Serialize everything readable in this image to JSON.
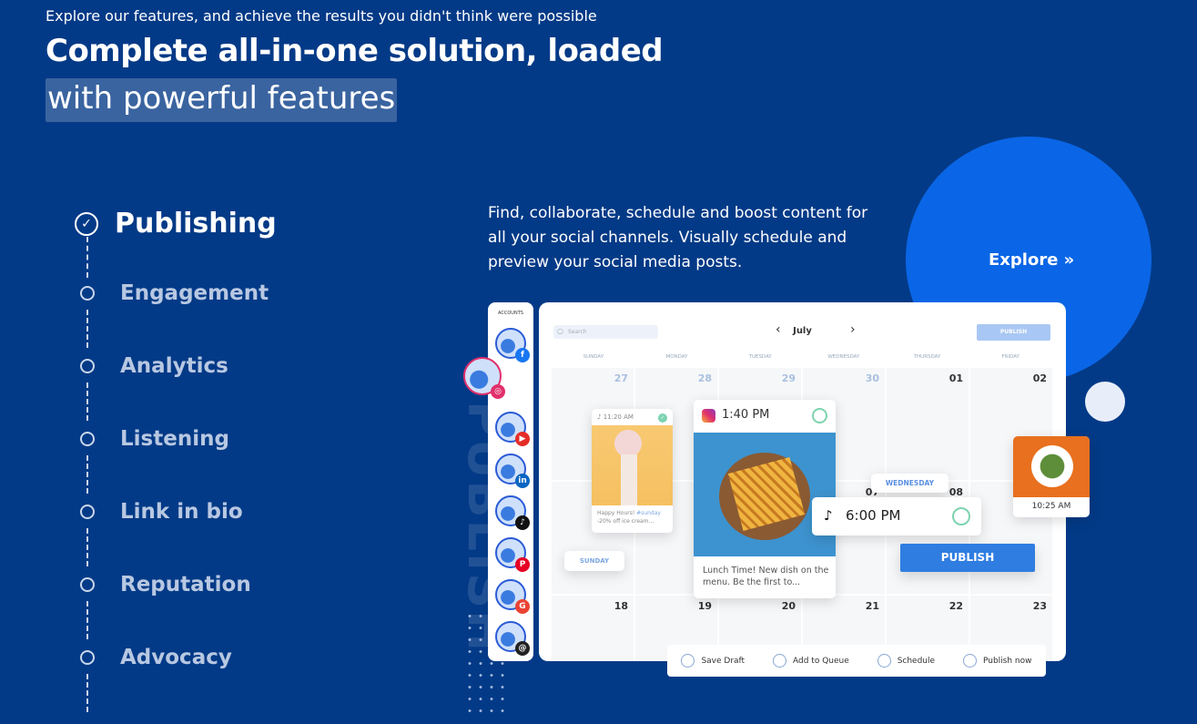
{
  "header": {
    "subtitle": "Explore our features, and achieve the results you didn't think were possible",
    "title_line1": "Complete all-in-one solution, loaded",
    "title_line2": "with powerful features"
  },
  "features": [
    {
      "label": "Publishing",
      "active": true
    },
    {
      "label": "Engagement"
    },
    {
      "label": "Analytics"
    },
    {
      "label": "Listening"
    },
    {
      "label": "Link in bio"
    },
    {
      "label": "Reputation"
    },
    {
      "label": "Advocacy"
    }
  ],
  "description": "Find, collaborate, schedule and boost content for all your social channels. Visually schedule and preview your social media posts.",
  "explore_label": "Explore »",
  "watermark": "PUBLISH",
  "accounts": {
    "title": "ACCOUNTS",
    "items": [
      {
        "network": "facebook",
        "icon": "f",
        "color": "#1877f2"
      },
      {
        "network": "instagram",
        "icon": "◎",
        "color": "#e1306c"
      },
      {
        "network": "youtube",
        "icon": "▶",
        "color": "#e52d27"
      },
      {
        "network": "linkedin",
        "icon": "in",
        "color": "#0a66c2"
      },
      {
        "network": "tiktok",
        "icon": "♪",
        "color": "#111111"
      },
      {
        "network": "pinterest",
        "icon": "P",
        "color": "#e60023"
      },
      {
        "network": "google",
        "icon": "G",
        "color": "#ea4335"
      },
      {
        "network": "threads",
        "icon": "@",
        "color": "#222222"
      }
    ]
  },
  "calendar": {
    "search_placeholder": "Search",
    "month": "July",
    "publish_label": "PUBLISH",
    "days": [
      "SUNDAY",
      "MONDAY",
      "TUESDAY",
      "WEDNESDAY",
      "THURSDAY",
      "FRIDAY"
    ],
    "row1": [
      "27",
      "28",
      "29",
      "30",
      "01",
      "02"
    ],
    "row1_dim": [
      true,
      true,
      true,
      true,
      false,
      false
    ],
    "row2": [
      "",
      "",
      "",
      "07",
      "08",
      ""
    ],
    "row3": [
      "18",
      "19",
      "20",
      "21",
      "22",
      "23"
    ]
  },
  "posts": {
    "tiktok_small": {
      "time": "11:20 AM",
      "caption": "Happy Hours! ",
      "hashtag": "#sunday",
      "caption2": "-20% off ice cream..."
    },
    "instagram": {
      "time": "1:40 PM",
      "caption": "Lunch Time! New dish on the menu. Be the first to..."
    },
    "tiktok_big": {
      "time": "6:00 PM"
    },
    "salad": {
      "time": "10:25 AM"
    },
    "sunday_tag": "SUNDAY",
    "wednesday_tag": "WEDNESDAY",
    "publish_button": "PUBLISH"
  },
  "options": [
    "Save Draft",
    "Add to Queue",
    "Schedule",
    "Publish now"
  ],
  "colors": {
    "background": "#033a87",
    "accent": "#0a66e6",
    "publish": "#2f7de1",
    "check": "#7dd3b0"
  }
}
